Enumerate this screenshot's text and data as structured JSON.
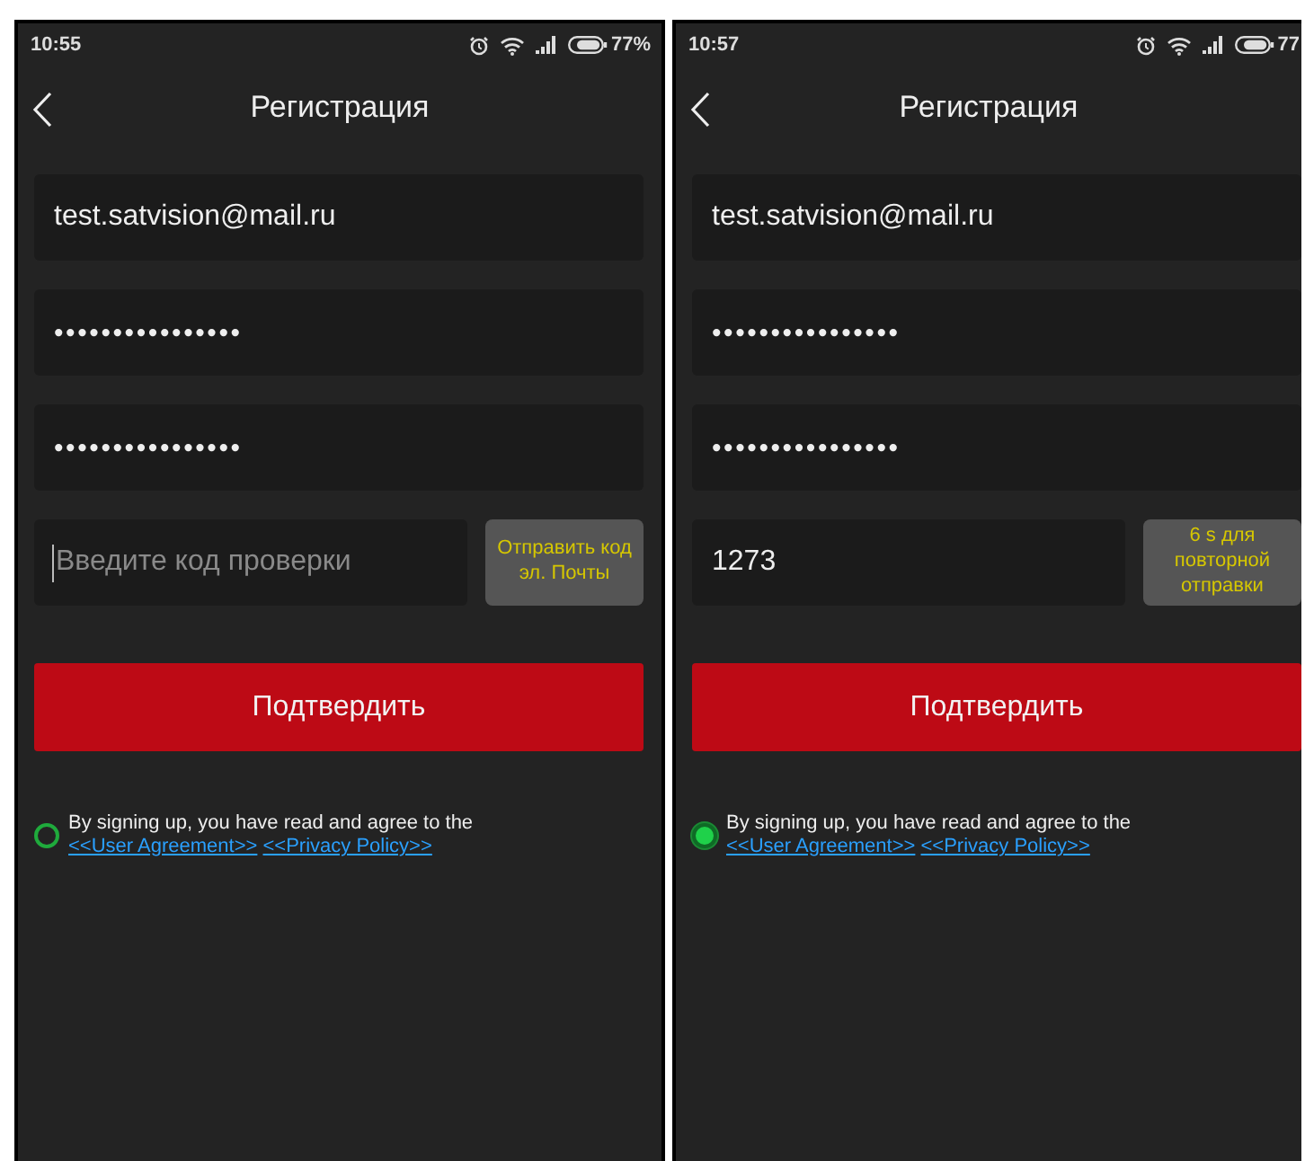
{
  "screens": [
    {
      "status_bar": {
        "time": "10:55",
        "battery": "77%"
      },
      "header": {
        "title": "Регистрация"
      },
      "fields": [
        {
          "kind": "text",
          "value": "test.satvision@mail.ru"
        },
        {
          "kind": "password",
          "value": "••••••••••••••••"
        },
        {
          "kind": "password",
          "value": "••••••••••••••••"
        }
      ],
      "code_field": {
        "placeholder": "Введите код проверки",
        "focused": true
      },
      "code_button": {
        "label": "Отправить код эл. Почты"
      },
      "submit": {
        "label": "Подтвердить"
      },
      "agreement": {
        "checked": false,
        "text": "By signing up, you have read and agree to the",
        "links": [
          "<<User Agreement>>",
          "<<Privacy Policy>>"
        ]
      }
    },
    {
      "status_bar": {
        "time": "10:57",
        "battery": "77"
      },
      "header": {
        "title": "Регистрация"
      },
      "fields": [
        {
          "kind": "text",
          "value": "test.satvision@mail.ru"
        },
        {
          "kind": "password",
          "value": "••••••••••••••••"
        },
        {
          "kind": "password",
          "value": "••••••••••••••••"
        }
      ],
      "code_field": {
        "value": "1273",
        "focused": false
      },
      "code_button": {
        "label": "6 s для повторной отправки"
      },
      "submit": {
        "label": "Подтвердить"
      },
      "agreement": {
        "checked": true,
        "text": "By signing up, you have read and agree to the",
        "links": [
          "<<User Agreement>>",
          "<<Privacy Policy>>"
        ]
      }
    }
  ]
}
